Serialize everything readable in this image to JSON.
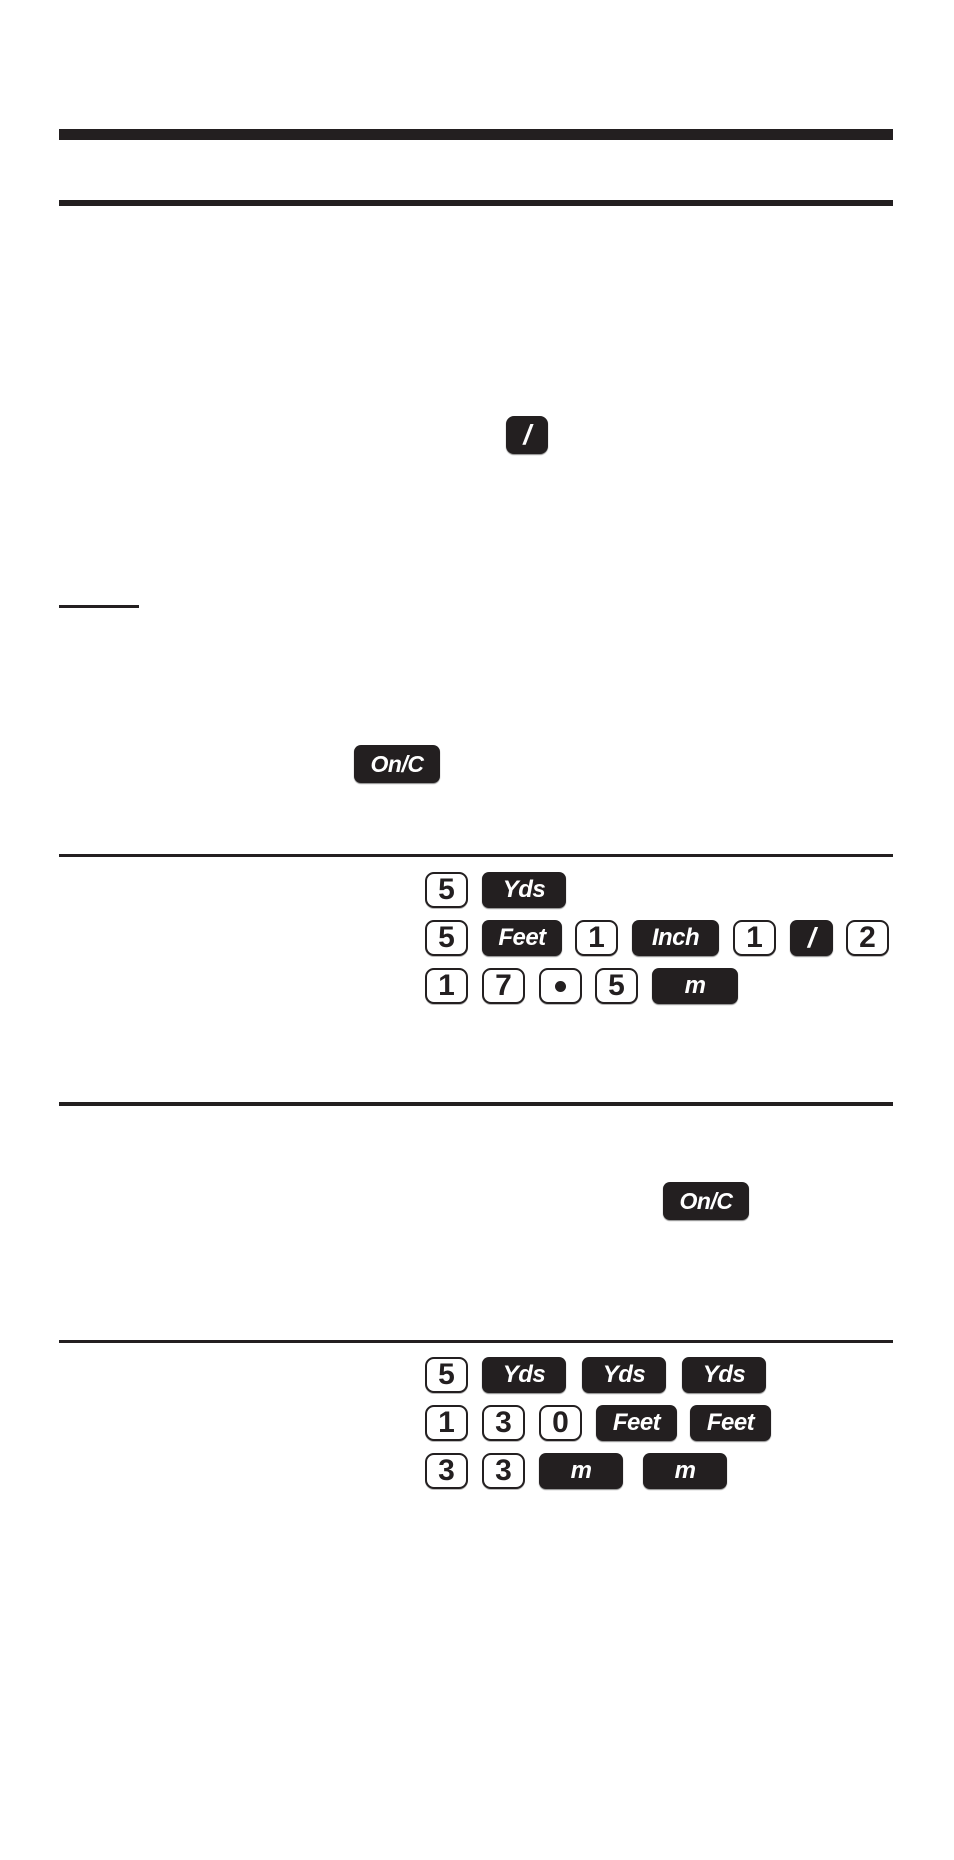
{
  "page": {
    "background": "#ffffff",
    "ink_color": "#231f20"
  },
  "keys": {
    "divide": "/",
    "on_clear": "On/C",
    "yards": "Yds",
    "feet": "Feet",
    "inch": "Inch",
    "meters": "m",
    "decimal_point": "decimal-point-dot"
  },
  "intro": {
    "inline_key_divide": "/",
    "inline_key_on_clear": "On/C"
  },
  "example_1": {
    "rows": [
      {
        "keys": [
          "5",
          "Yds"
        ]
      },
      {
        "keys": [
          "5",
          "Feet",
          "1",
          "Inch",
          "1",
          "/",
          "2"
        ]
      },
      {
        "keys": [
          "1",
          "7",
          "•",
          "5",
          "m"
        ]
      }
    ]
  },
  "section_2": {
    "inline_key_on_clear": "On/C"
  },
  "example_2": {
    "rows": [
      {
        "keys": [
          "5",
          "Yds",
          "Yds",
          "Yds"
        ]
      },
      {
        "keys": [
          "1",
          "3",
          "0",
          "Feet",
          "Feet"
        ]
      },
      {
        "keys": [
          "3",
          "3",
          "m",
          "m"
        ]
      }
    ]
  }
}
